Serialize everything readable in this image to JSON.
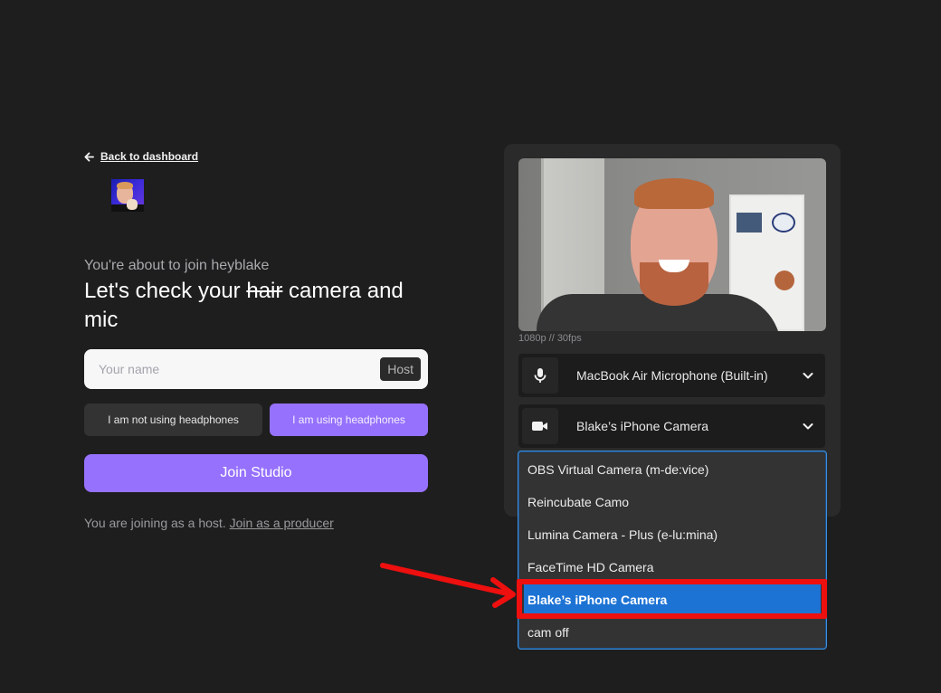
{
  "nav": {
    "back_label": "Back to dashboard"
  },
  "intro": {
    "subtitle": "You're about to join heyblake",
    "headline_prefix": "Let's check your ",
    "headline_struck": "hair",
    "headline_suffix": " camera and mic"
  },
  "form": {
    "name_placeholder": "Your name",
    "name_value": "",
    "role_badge": "Host",
    "headphones_off_label": "I am not using headphones",
    "headphones_on_label": "I am using headphones",
    "headphones_selected": "on",
    "join_label": "Join Studio",
    "joining_note": "You are joining as a host. ",
    "producer_link": "Join as a producer"
  },
  "preview": {
    "meta": "1080p // 30fps",
    "microphone": {
      "icon": "microphone-icon",
      "selected": "MacBook Air Microphone (Built-in)"
    },
    "camera": {
      "icon": "video-camera-icon",
      "selected": "Blake’s iPhone Camera"
    },
    "camera_options": [
      {
        "label": "OBS Virtual Camera (m-de:vice)",
        "selected": false
      },
      {
        "label": "Reincubate Camo",
        "selected": false
      },
      {
        "label": "Lumina Camera - Plus (e-lu:mina)",
        "selected": false
      },
      {
        "label": "FaceTime HD Camera",
        "selected": false
      },
      {
        "label": "Blake’s iPhone Camera",
        "selected": true
      },
      {
        "label": "cam off",
        "selected": false
      }
    ]
  },
  "annotation": {
    "color": "#ee0f0f",
    "target": "Blake’s iPhone Camera"
  },
  "colors": {
    "accent": "#9671fd",
    "background": "#1e1e1e",
    "selection": "#1d73d4"
  }
}
